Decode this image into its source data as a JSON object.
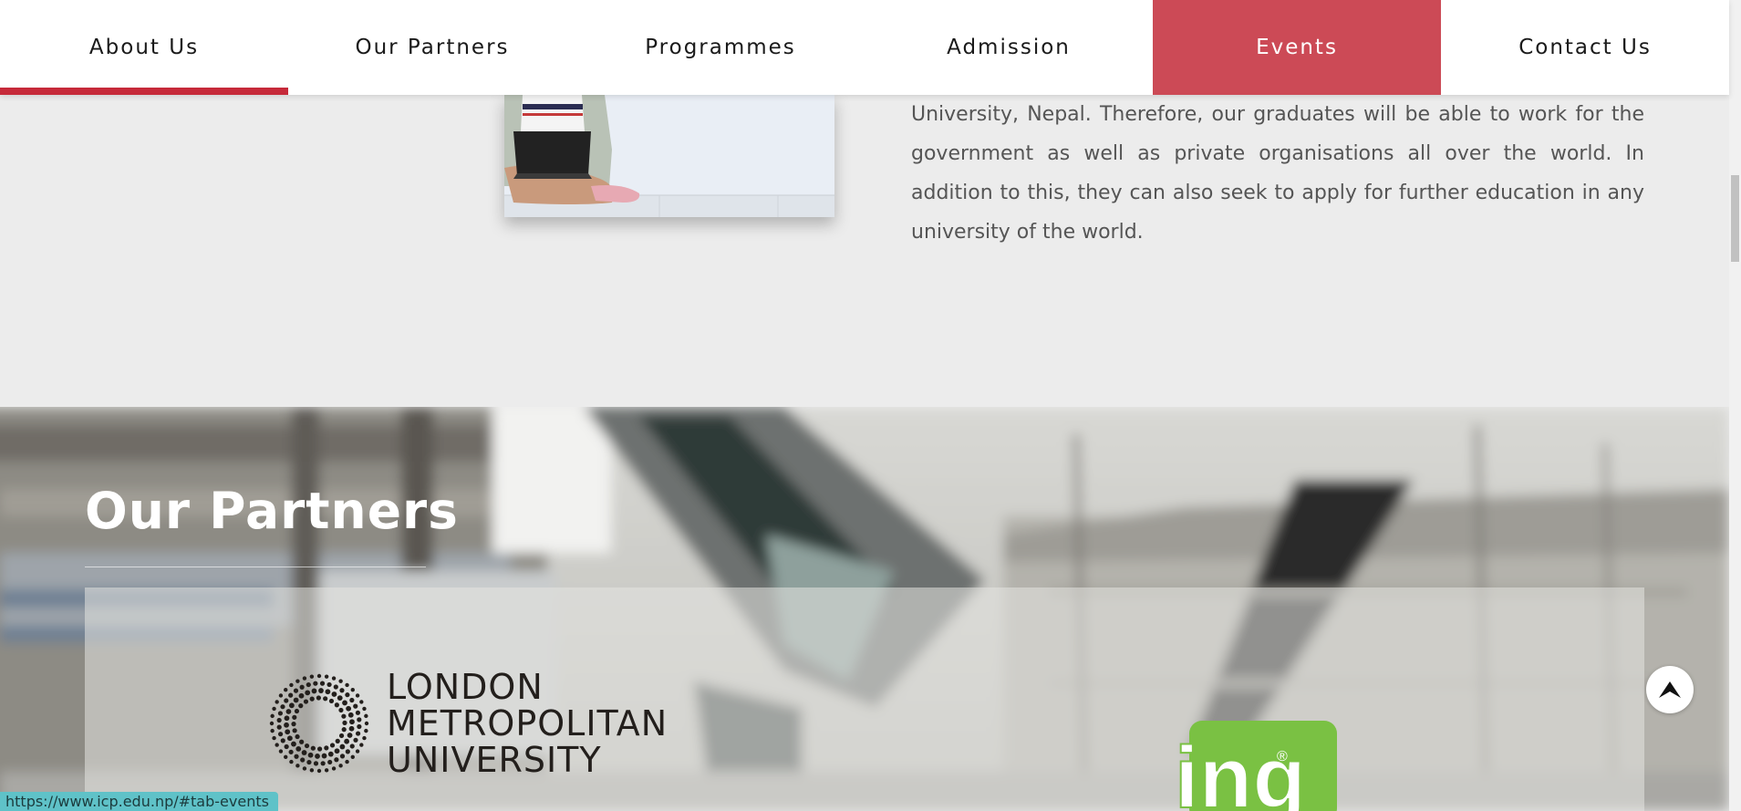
{
  "tabs": [
    {
      "label": "About Us",
      "state": "active"
    },
    {
      "label": "Our Partners",
      "state": "normal"
    },
    {
      "label": "Programmes",
      "state": "normal"
    },
    {
      "label": "Admission",
      "state": "normal"
    },
    {
      "label": "Events",
      "state": "hover"
    },
    {
      "label": "Contact Us",
      "state": "normal"
    }
  ],
  "about": {
    "body_text": "University, Nepal. Therefore, our graduates will be able to work for the government as well as private organisations all over the world. In addition to this, they can also seek to apply for further education in any university of the world.",
    "photo_icon": "student-with-laptop-photo"
  },
  "partners": {
    "title": "Our Partners",
    "logos": [
      {
        "name": "london-metropolitan-university-logo",
        "lines": [
          "LONDON",
          "METROPOLITAN",
          "UNIVERSITY"
        ]
      },
      {
        "name": "ing-logo",
        "text": "ing",
        "mark": "®"
      }
    ]
  },
  "back_to_top": {
    "icon": "chevron-up-icon"
  },
  "status_bar": {
    "url": "https://www.icp.edu.np/#tab-events"
  },
  "colors": {
    "accent_red": "#c62a3a",
    "events_tab_bg": "#cc4a56",
    "ing_green": "#7ac143",
    "status_bg": "#5fc2c8"
  }
}
